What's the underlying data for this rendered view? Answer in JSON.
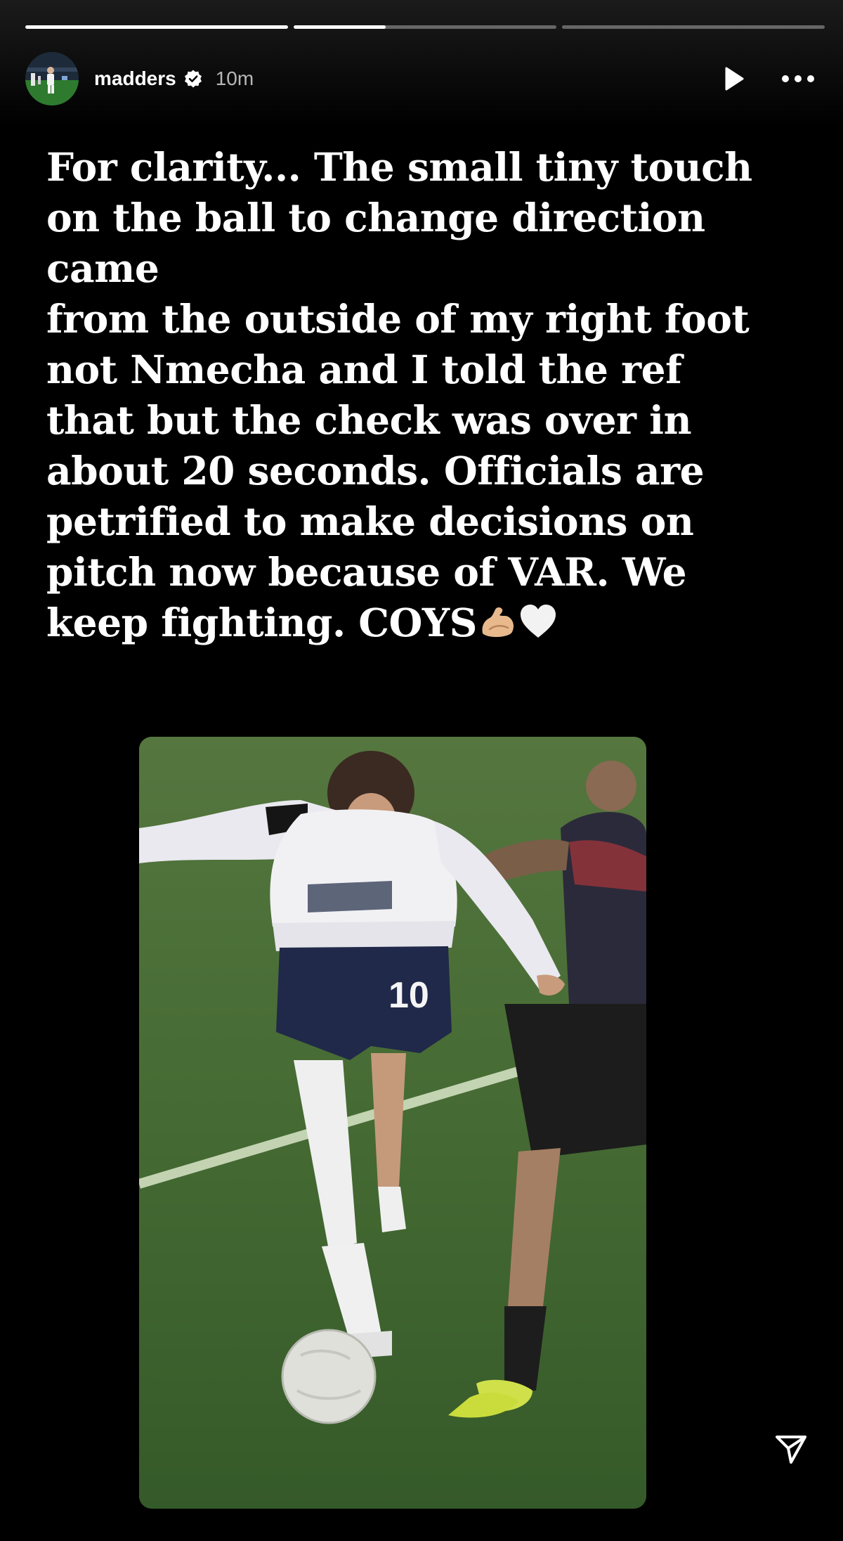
{
  "progress": {
    "segments": [
      1.0,
      0.35,
      0.0
    ]
  },
  "header": {
    "username": "madders",
    "time": "10m",
    "icons": {
      "verified": "verified-badge-icon",
      "play": "play-icon",
      "more": "more-icon"
    }
  },
  "caption": {
    "lines": [
      "For clarity... The small tiny touch",
      "on the ball to change direction",
      "came",
      "from the outside of my right foot",
      "not Nmecha and I told the ref",
      "that but the check was over in",
      "about 20 seconds. Officials are",
      "petrified to make decisions on",
      "pitch now because of VAR. We",
      "keep fighting. COYS"
    ],
    "emojis": [
      "flexed-biceps-emoji",
      "white-heart-emoji"
    ]
  },
  "photo": {
    "shirt_number": "10"
  },
  "footer": {
    "share_icon": "send-icon"
  },
  "colors": {
    "background": "#000000",
    "text": "#ffffff",
    "muted_text": "#b3b3b3",
    "pitch_green": "#3d5e2d",
    "progress_track": "#595959"
  }
}
